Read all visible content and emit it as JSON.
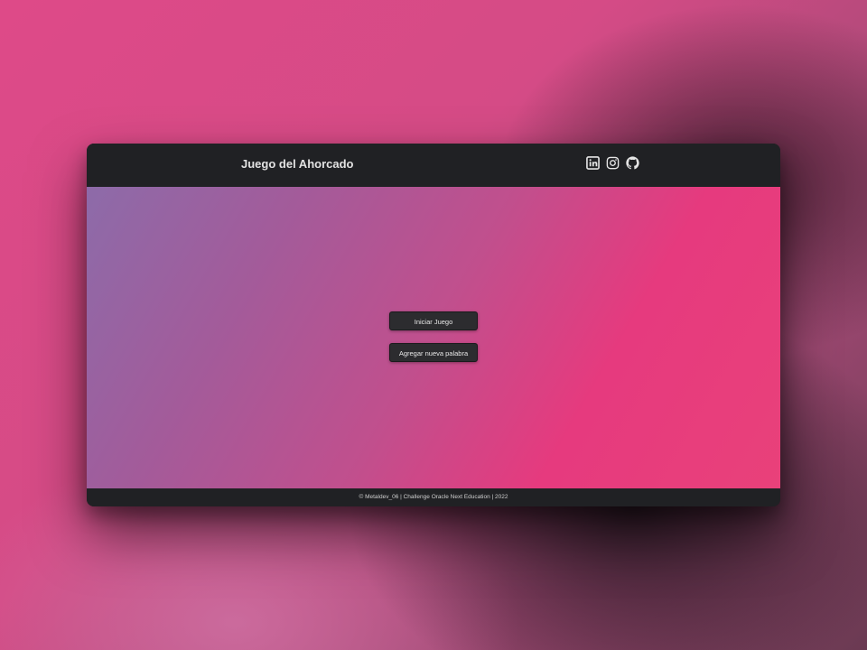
{
  "header": {
    "title": "Juego del Ahorcado",
    "social_icons": [
      "linkedin-icon",
      "instagram-icon",
      "github-icon"
    ]
  },
  "main": {
    "start_button_label": "Iniciar Juego",
    "add_word_button_label": "Agregar nueva palabra"
  },
  "footer": {
    "text": "© Metaldev_06 | Challenge Oracle Next Education | 2022"
  },
  "colors": {
    "bar": "#202124",
    "button": "#2c2c2f",
    "gradient_start": "#8d6ba9",
    "gradient_end": "#e63a7e"
  }
}
